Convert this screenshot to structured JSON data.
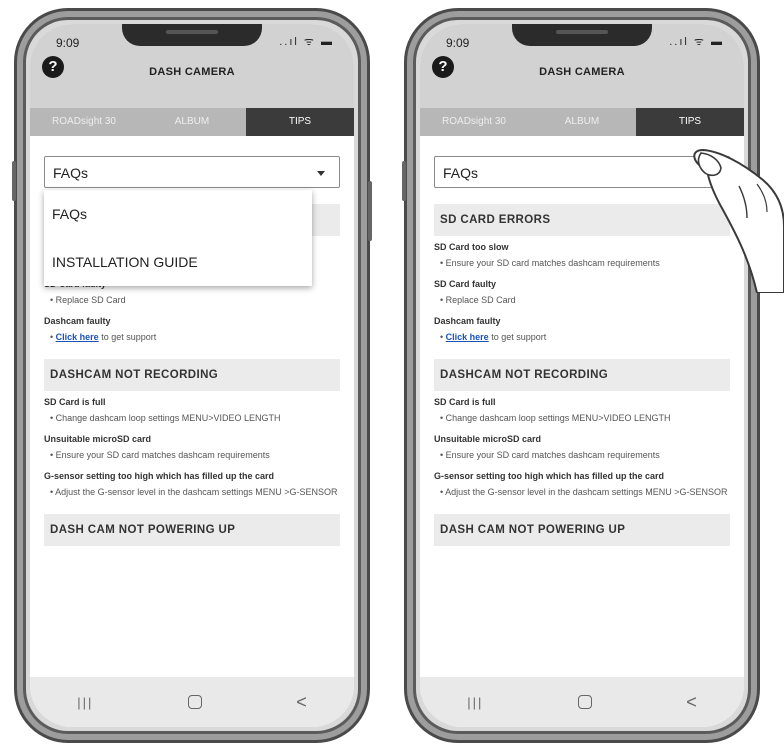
{
  "status": {
    "time": "9:09",
    "icons": "..ıl ᯤ ▬"
  },
  "app": {
    "title": "DASH CAMERA"
  },
  "tabs": [
    "ROADsight 30",
    "ALBUM",
    "TIPS"
  ],
  "select": {
    "value": "FAQs",
    "options": [
      "FAQs",
      "INSTALLATION GUIDE"
    ]
  },
  "sections": [
    {
      "header": "SD CARD ERRORS",
      "issues": [
        {
          "title": "SD Card too slow",
          "solution": "• Ensure your SD card matches dashcam requirements"
        },
        {
          "title": "SD Card faulty",
          "solution": "• Replace SD Card"
        },
        {
          "title": "Dashcam faulty",
          "solution_link": "Click here",
          "solution_rest": " to get support"
        }
      ]
    },
    {
      "header": "DASHCAM NOT RECORDING",
      "issues": [
        {
          "title": "SD Card is full",
          "solution": "• Change dashcam loop settings MENU>VIDEO LENGTH"
        },
        {
          "title": "Unsuitable microSD card",
          "solution": "• Ensure your SD card matches dashcam requirements"
        },
        {
          "title": "G-sensor setting too high which has filled up the card",
          "solution": "• Adjust the G-sensor level in the dashcam settings MENU >G-SENSOR"
        }
      ]
    },
    {
      "header": "DASH CAM NOT POWERING UP"
    }
  ],
  "nav": {
    "recent": "|||",
    "back": "<"
  },
  "colors": {
    "active_tab": "#3b3b3b",
    "link": "#1a52b5",
    "section_bg": "#ebebeb"
  },
  "icons": [
    "help-icon",
    "signal-icon",
    "wifi-icon",
    "battery-icon",
    "chevron-down-icon",
    "hand-icon"
  ]
}
